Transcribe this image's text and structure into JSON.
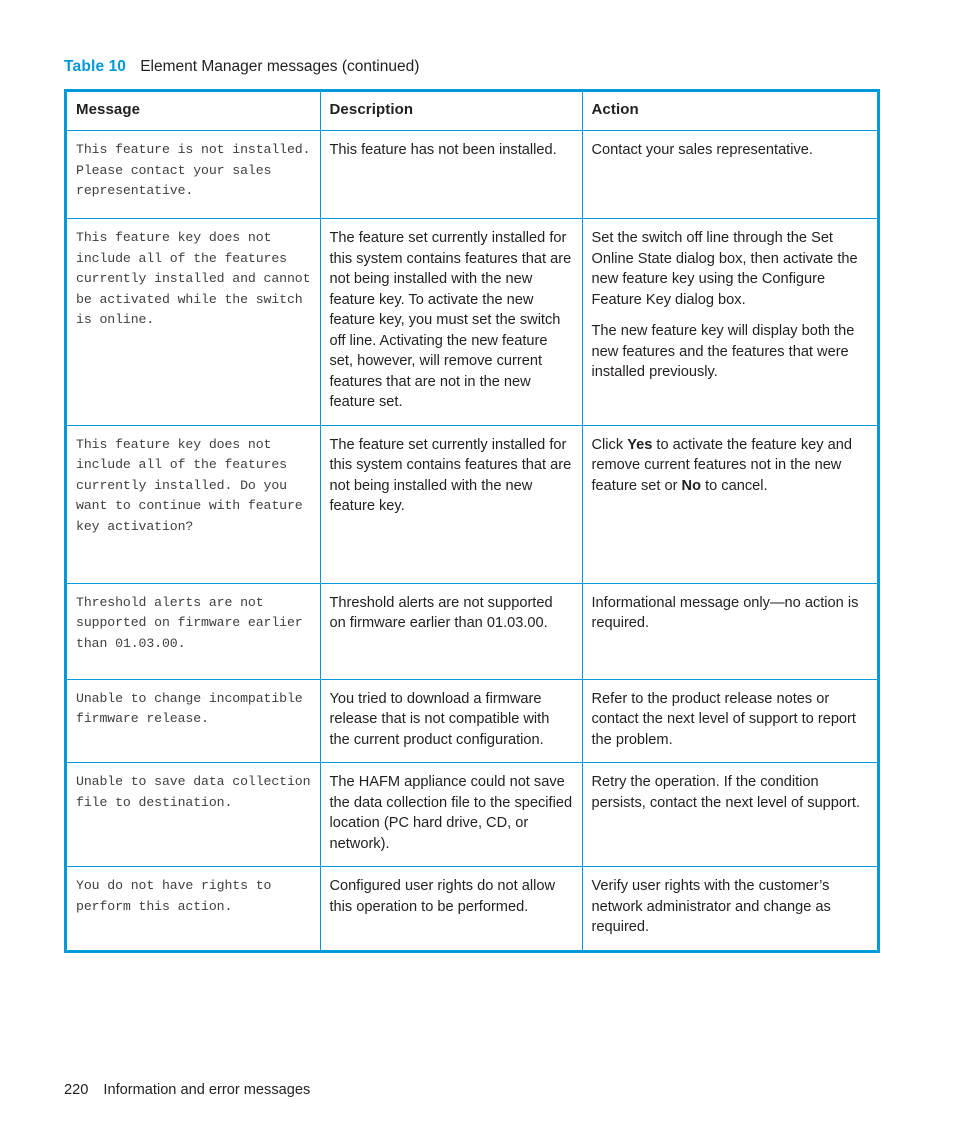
{
  "caption": {
    "label": "Table",
    "number": "10",
    "text": "Element Manager messages (continued)"
  },
  "table": {
    "headers": {
      "message": "Message",
      "description": "Description",
      "action": "Action"
    },
    "rows": [
      {
        "message": "This feature is not installed. Please contact your sales representative.",
        "description": "This feature has not been installed.",
        "action": "Contact your sales representative."
      },
      {
        "message": "This feature key does not include all of the features currently installed and cannot be activated while the switch is online.",
        "description": "The feature set currently installed for this system contains features that are not being installed with the new feature key. To activate the new feature key, you must set the switch off line. Activating the new feature set, however, will remove current features that are not in the new feature set.",
        "action_p1": "Set the switch off line through the Set Online State dialog box, then activate the new feature key using the Configure Feature Key dialog box.",
        "action_p2": "The new feature key will display both the new features and the features that were installed previously."
      },
      {
        "message": "This feature key does not include all of the features currently installed. Do you want to continue with feature key activation?",
        "description": "The feature set currently installed for this system contains features that are not being installed with the new feature key.",
        "action_pre": "Click ",
        "action_bold1": "Yes",
        "action_mid": " to activate the feature key and remove current features not in the new feature set or ",
        "action_bold2": "No",
        "action_post": " to cancel."
      },
      {
        "message": "Threshold alerts are not supported on firmware earlier than 01.03.00.",
        "description": "Threshold alerts are not supported on firmware earlier than 01.03.00.",
        "action": "Informational message only—no action is required."
      },
      {
        "message": "Unable to change incompatible firmware release.",
        "description": "You tried to download a firmware release that is not compatible with the current product configuration.",
        "action": "Refer to the product release notes or contact the next level of support to report the problem."
      },
      {
        "message": "Unable to save data collection file to destination.",
        "description": "The HAFM appliance could not save the data collection file to the specified location (PC hard drive, CD, or network).",
        "action": "Retry the operation. If the condition persists, contact the next level of support."
      },
      {
        "message": "You do not have rights to perform this action.",
        "description": "Configured user rights do not allow this operation to be performed.",
        "action": "Verify user rights with the customer’s network administrator and change as required."
      }
    ]
  },
  "footer": {
    "page_number": "220",
    "section_title": "Information and error messages"
  },
  "colors": {
    "accent": "#009ad8",
    "body_text": "#231f20",
    "mono_text": "#3f3f3f"
  }
}
